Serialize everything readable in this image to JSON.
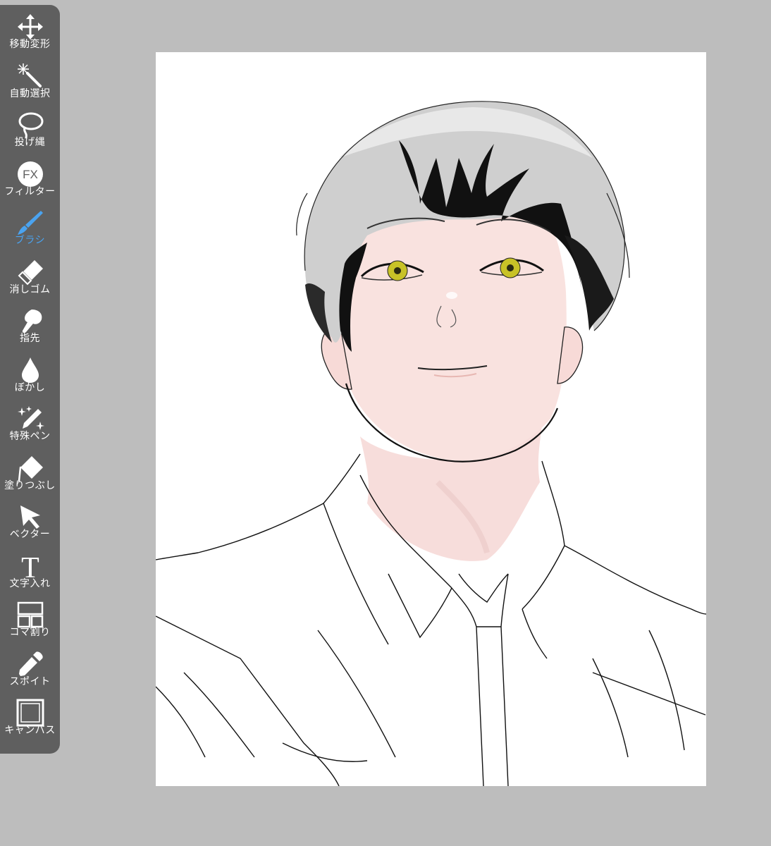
{
  "app": {
    "background_color": "#bdbdbd",
    "toolbar_color": "#5f5f5f",
    "active_color": "#4aa3f0"
  },
  "toolbar": {
    "tools": [
      {
        "label": "移動変形",
        "icon": "move-transform-icon",
        "active": false
      },
      {
        "label": "自動選択",
        "icon": "magic-wand-icon",
        "active": false
      },
      {
        "label": "投げ縄",
        "icon": "lasso-icon",
        "active": false
      },
      {
        "label": "フィルター",
        "icon": "fx-filter-icon",
        "active": false
      },
      {
        "label": "ブラシ",
        "icon": "brush-icon",
        "active": true
      },
      {
        "label": "消しゴム",
        "icon": "eraser-icon",
        "active": false
      },
      {
        "label": "指先",
        "icon": "finger-smudge-icon",
        "active": false
      },
      {
        "label": "ぼかし",
        "icon": "blur-drop-icon",
        "active": false
      },
      {
        "label": "特殊ペン",
        "icon": "special-pen-icon",
        "active": false
      },
      {
        "label": "塗りつぶし",
        "icon": "fill-bucket-icon",
        "active": false
      },
      {
        "label": "ベクター",
        "icon": "vector-cursor-icon",
        "active": false
      },
      {
        "label": "文字入れ",
        "icon": "text-icon",
        "active": false
      },
      {
        "label": "コマ割り",
        "icon": "panel-layout-icon",
        "active": false
      },
      {
        "label": "スポイト",
        "icon": "eyedropper-icon",
        "active": false
      },
      {
        "label": "キャンバス",
        "icon": "canvas-icon",
        "active": false
      }
    ],
    "fx_text": "FX",
    "text_tool_glyph": "T"
  },
  "canvas": {
    "background": "#ffffff",
    "artwork": "illustration-portrait"
  }
}
